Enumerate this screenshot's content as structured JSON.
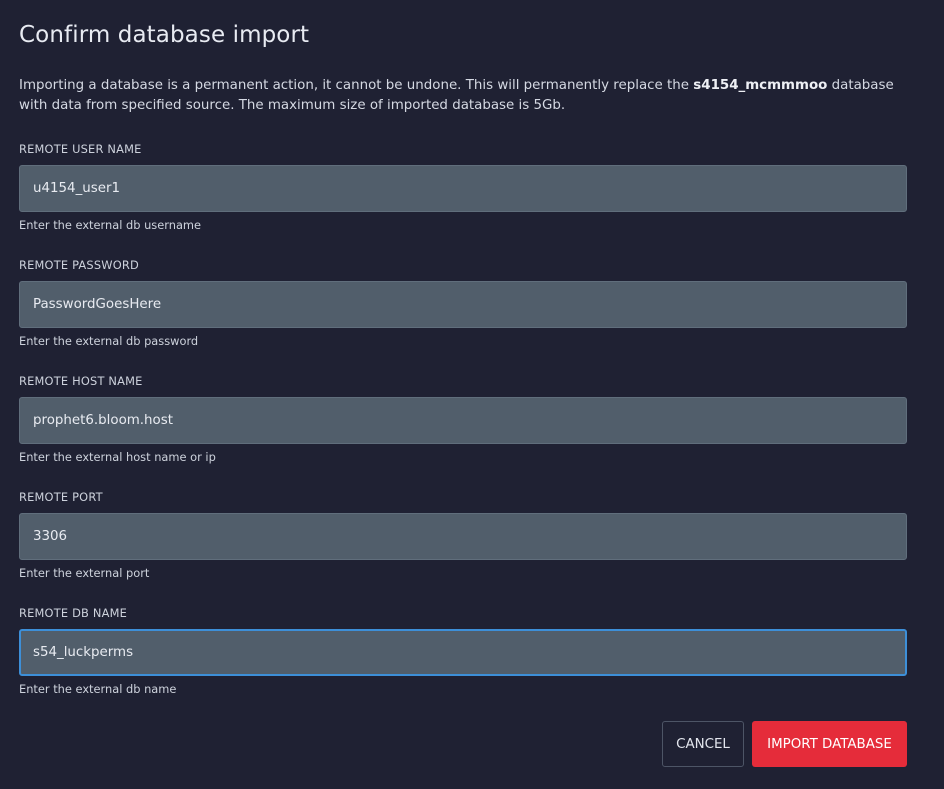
{
  "dialog": {
    "title": "Confirm database import",
    "description_before": "Importing a database is a permanent action, it cannot be undone. This will permanently replace the ",
    "database_name": "s4154_mcmmmoo",
    "description_after": " database with data from specified source. The maximum size of imported database is 5Gb."
  },
  "fields": {
    "user": {
      "label": "REMOTE USER NAME",
      "value": "u4154_user1",
      "helper": "Enter the external db username"
    },
    "password": {
      "label": "REMOTE PASSWORD",
      "value": "PasswordGoesHere",
      "helper": "Enter the external db password"
    },
    "host": {
      "label": "REMOTE HOST NAME",
      "value": "prophet6.bloom.host",
      "helper": "Enter the external host name or ip"
    },
    "port": {
      "label": "REMOTE PORT",
      "value": "3306",
      "helper": "Enter the external port"
    },
    "dbname": {
      "label": "REMOTE DB NAME",
      "value": "s54_luckperms",
      "helper": "Enter the external db name"
    }
  },
  "buttons": {
    "cancel_label": "CANCEL",
    "import_label": "IMPORT DATABASE"
  },
  "colors": {
    "background": "#1f2133",
    "input_background": "#515e6b",
    "focus_border": "#3d8fd8",
    "primary_button": "#e52c3a"
  }
}
